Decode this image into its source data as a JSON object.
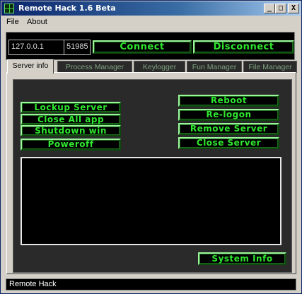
{
  "window": {
    "title": "Remote Hack 1.6 Beta",
    "controls": {
      "minimize": "_",
      "maximize": "□",
      "close": "X"
    }
  },
  "menu": {
    "file": "File",
    "about": "About"
  },
  "connection": {
    "host_value": "127.0.0.1",
    "port_value": "51985",
    "connect_label": "Connect",
    "disconnect_label": "Disconnect"
  },
  "tabs": [
    {
      "label": "Server info",
      "active": true
    },
    {
      "label": "Process Manager",
      "active": false
    },
    {
      "label": "Keylogger",
      "active": false
    },
    {
      "label": "Fun Manager",
      "active": false
    },
    {
      "label": "File Manager",
      "active": false
    }
  ],
  "server_info": {
    "left_buttons": [
      "Lockup Server",
      "Close All app",
      "Shutdown win",
      "Poweroff"
    ],
    "right_buttons": [
      "Reboot",
      "Re-logon",
      "Remove Server",
      "Close Server"
    ],
    "system_info_label": "System Info"
  },
  "status": {
    "text": "Remote Hack"
  },
  "colors": {
    "accent_green": "#2ee82e",
    "panel_black": "#000000",
    "titlebar": "#0a246a"
  }
}
